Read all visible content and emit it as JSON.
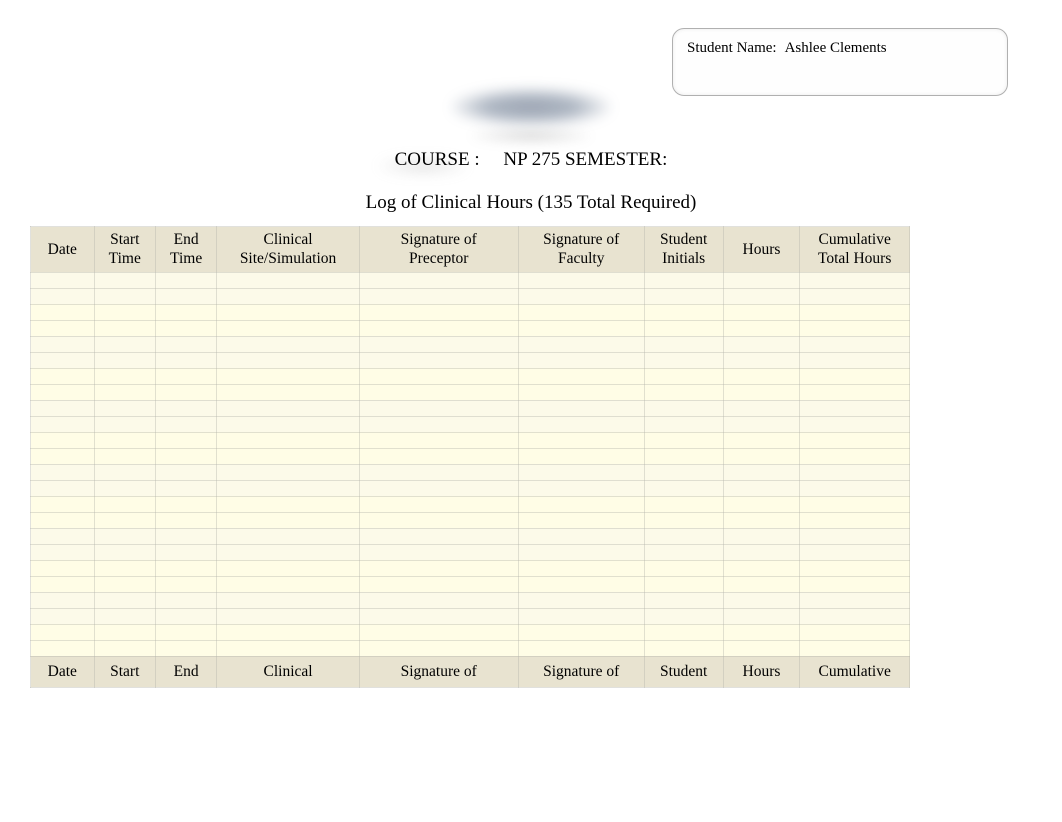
{
  "student_box": {
    "label": "Student Name:",
    "value": "Ashlee Clements"
  },
  "course_line": {
    "label": "COURSE :",
    "value": "NP 275 SEMESTER:"
  },
  "log_title": "Log of Clinical Hours (135 Total Required)",
  "headers": {
    "date": {
      "l1": "Date",
      "l2": ""
    },
    "start": {
      "l1": "Start",
      "l2": "Time"
    },
    "end": {
      "l1": "End",
      "l2": "Time"
    },
    "site": {
      "l1": "Clinical",
      "l2": "Site/Simulation"
    },
    "precep": {
      "l1": "Signature of",
      "l2": "Preceptor"
    },
    "faculty": {
      "l1": "Signature of",
      "l2": "Faculty"
    },
    "initials": {
      "l1": "Student",
      "l2": "Initials"
    },
    "hours": {
      "l1": "Hours",
      "l2": ""
    },
    "cum": {
      "l1": "Cumulative",
      "l2": "Total Hours"
    }
  },
  "footers": {
    "date": "Date",
    "start": "Start",
    "end": "End",
    "site": "Clinical",
    "precep": "Signature of",
    "faculty": "Signature of",
    "initials": "Student",
    "hours": "Hours",
    "cum": "Cumulative"
  },
  "blank_row_count": 24
}
